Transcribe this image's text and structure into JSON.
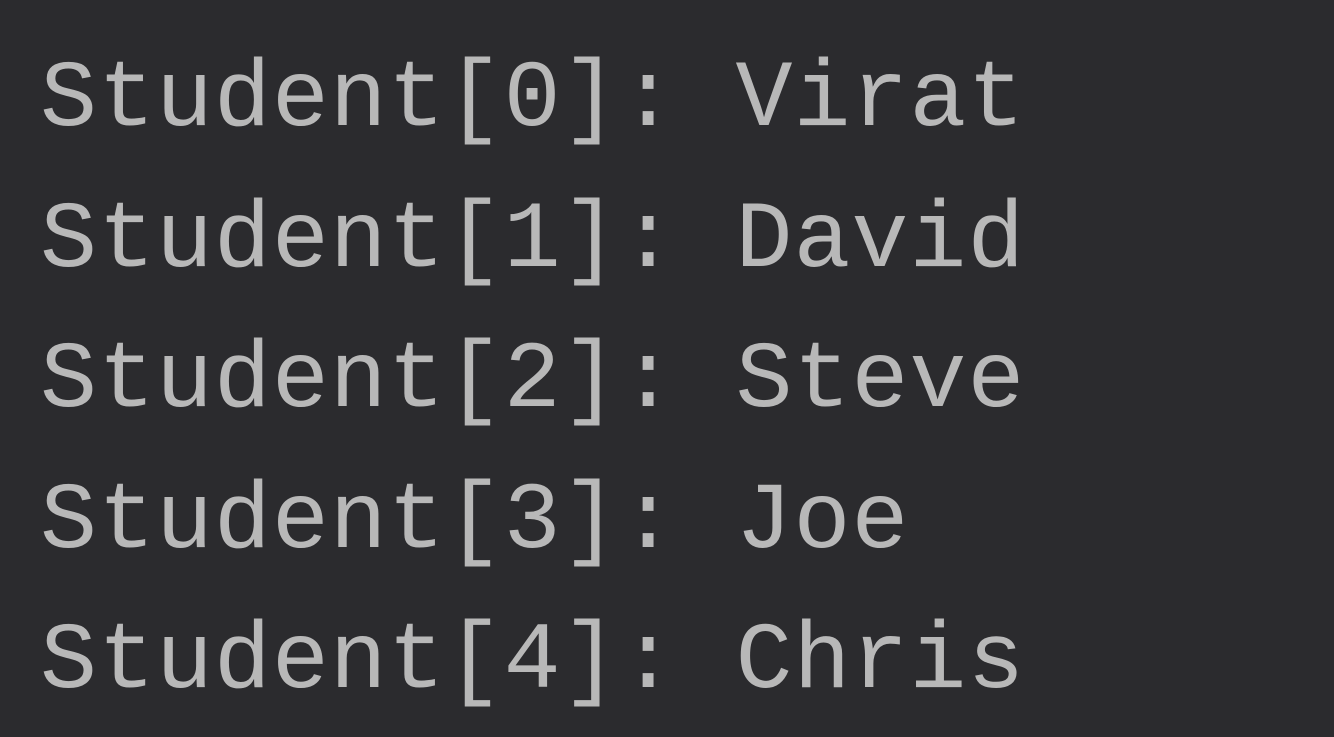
{
  "output": {
    "lines": [
      "Student[0]: Virat",
      "Student[1]: David",
      "Student[2]: Steve",
      "Student[3]: Joe",
      "Student[4]: Chris"
    ]
  }
}
